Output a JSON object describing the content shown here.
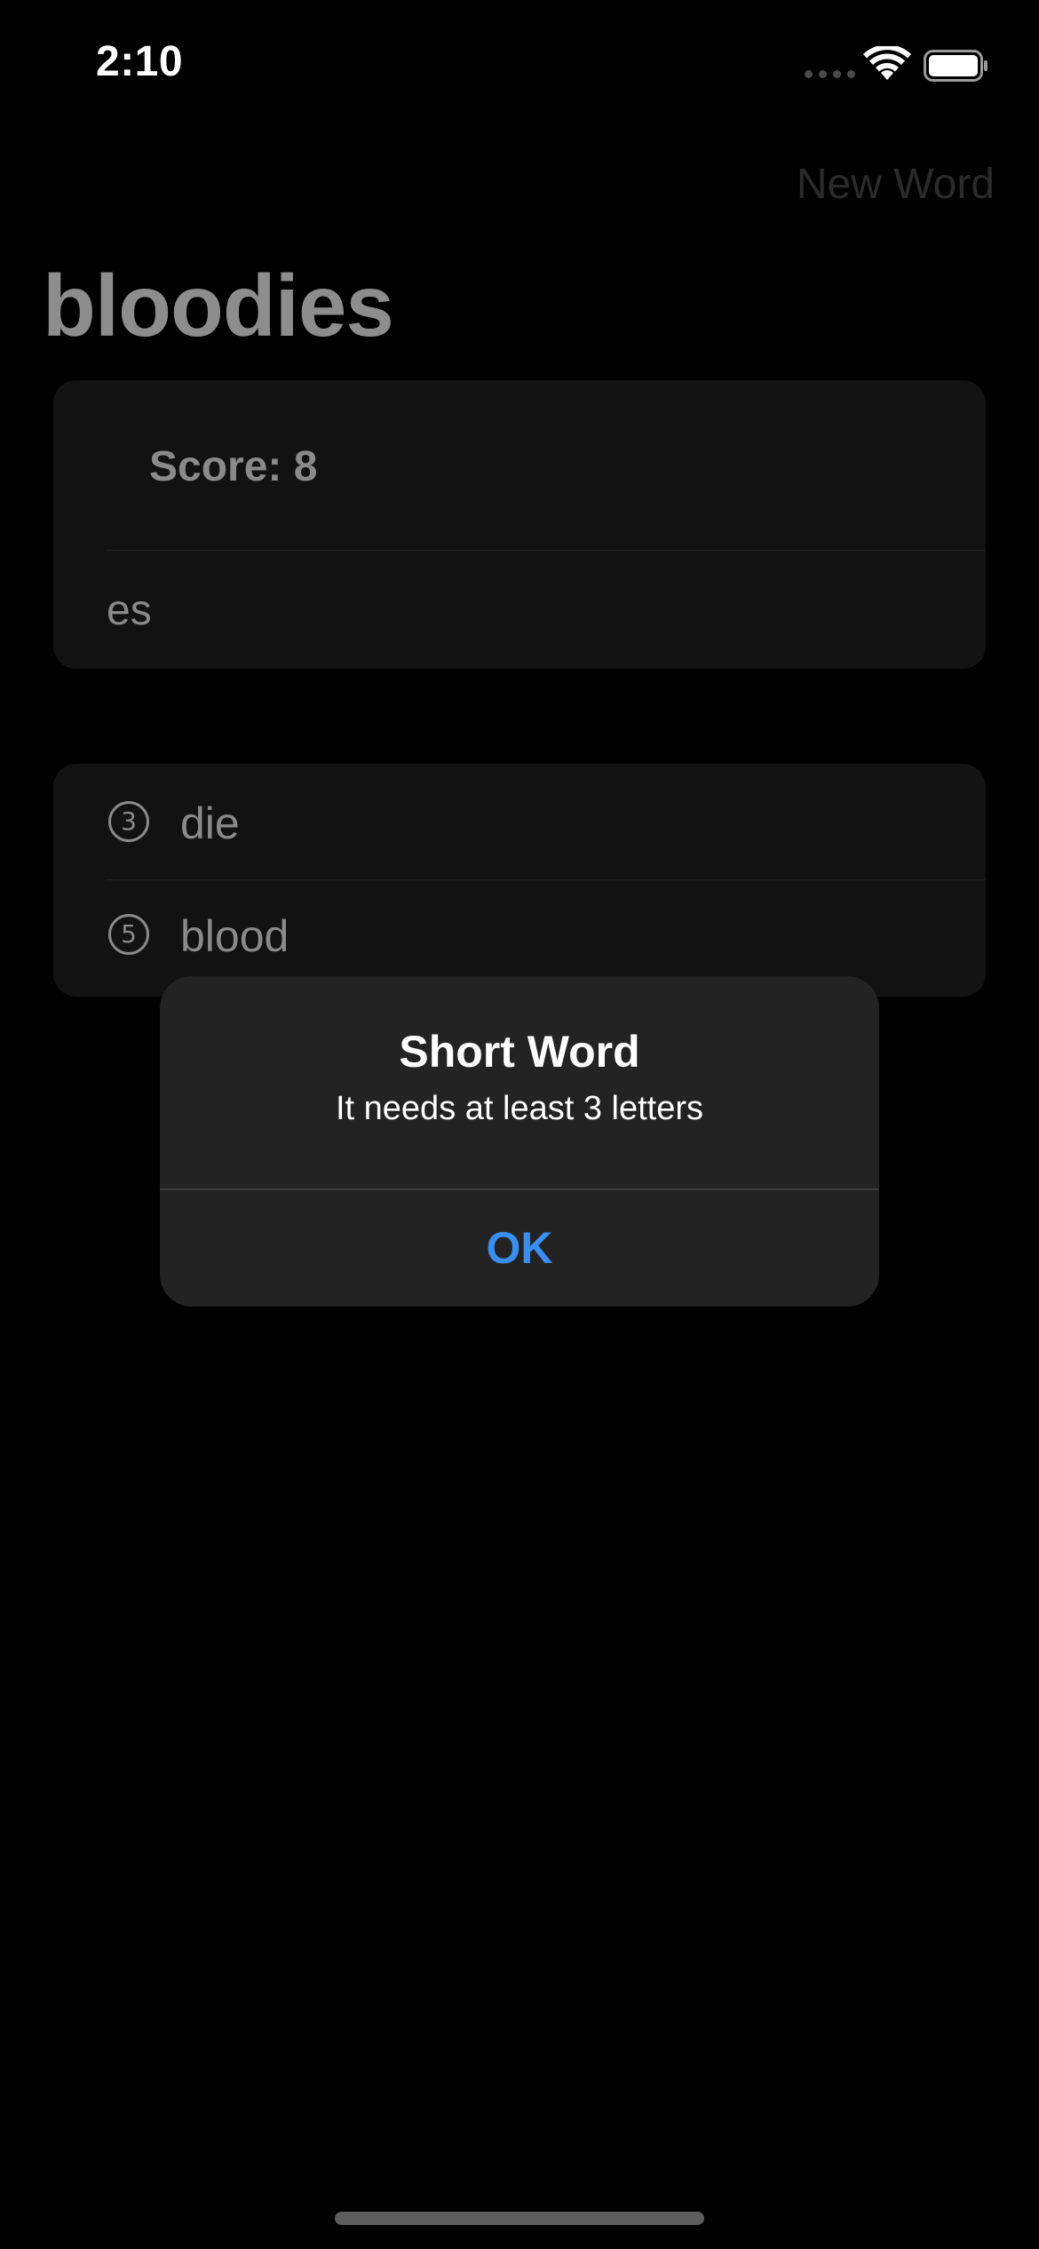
{
  "status_bar": {
    "time": "2:10"
  },
  "nav": {
    "new_word_label": "New Word"
  },
  "title": "bloodies",
  "score_card": {
    "score_label": "Score: 8",
    "entry_value": "es"
  },
  "used_words": [
    {
      "count": "3",
      "word": "die"
    },
    {
      "count": "5",
      "word": "blood"
    }
  ],
  "alert": {
    "title": "Short Word",
    "message": "It needs at least 3 letters",
    "ok_label": "OK"
  },
  "colors": {
    "accent": "#3a8ef0",
    "background": "#000000",
    "card": "#121212",
    "alert": "#232323"
  }
}
